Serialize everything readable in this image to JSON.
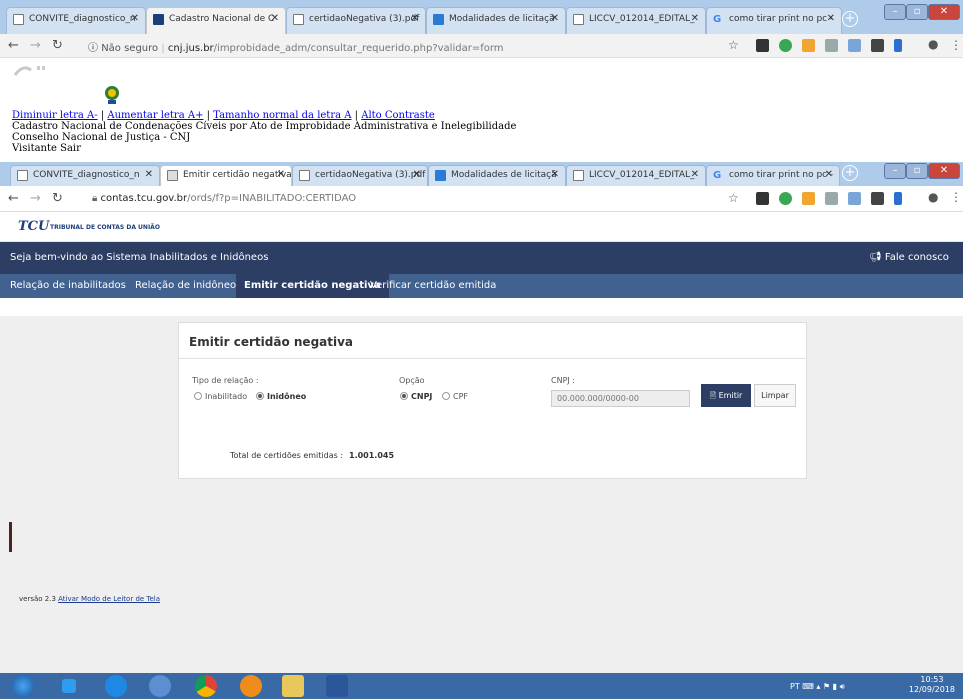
{
  "outer_browser": {
    "tabs": [
      {
        "label": "CONVITE_diagnostico_n"
      },
      {
        "label": "Cadastro Nacional de C"
      },
      {
        "label": "certidaoNegativa (3).pdf"
      },
      {
        "label": "Modalidades de licitaçã"
      },
      {
        "label": "LICCV_012014_EDITAL_"
      },
      {
        "label": "como tirar print no pc -"
      }
    ],
    "url_security": "Não seguro",
    "url_host": "cnj.jus.br",
    "url_path": "/improbidade_adm/consultar_requerido.php?validar=form"
  },
  "cnj_page": {
    "links": {
      "decrease": "Diminuir letra A-",
      "increase": "Aumentar letra A+",
      "normal": "Tamanho normal da letra A",
      "contrast": "Alto Contraste"
    },
    "sep": "|",
    "title": "Cadastro Nacional de Condenações Cíveis por Ato de Improbidade Administrativa e Inelegibilidade",
    "org": "Conselho Nacional de Justiça - CNJ",
    "user": "Visitante Sair"
  },
  "inner_browser": {
    "tabs": [
      {
        "label": "CONVITE_diagnostico_n"
      },
      {
        "label": "Emitir certidão negativa"
      },
      {
        "label": "certidaoNegativa (3).pdf"
      },
      {
        "label": "Modalidades de licitaçã"
      },
      {
        "label": "LICCV_012014_EDITAL_"
      },
      {
        "label": "como tirar print no pc -"
      }
    ],
    "url_host": "contas.tcu.gov.br",
    "url_path": "/ords/f?p=INABILITADO:CERTIDAO"
  },
  "tcu": {
    "logo": "TCU",
    "org_name": "TRIBUNAL DE CONTAS DA UNIÃO",
    "welcome": "Seja bem-vindo ao Sistema Inabilitados e Inidôneos",
    "contact": "Fale conosco",
    "menu": [
      "Relação de inabilitados",
      "Relação de inidôneos",
      "Emitir certidão negativa",
      "Verificar certidão emitida"
    ]
  },
  "form": {
    "title": "Emitir certidão negativa",
    "tipo_label": "Tipo de relação :",
    "tipo_options": [
      "Inabilitado",
      "Inidôneo"
    ],
    "opcao_label": "Opção",
    "opcao_options": [
      "CNPJ",
      "CPF"
    ],
    "cnpj_label": "CNPJ :",
    "cnpj_placeholder": "00.000.000/0000-00",
    "emitir": "Emitir",
    "limpar": "Limpar",
    "total_label": "Total de certidões emitidas :",
    "total_value": "1.001.045"
  },
  "footer": {
    "version": "versão 2.3",
    "link": "Ativar Modo de Leitor de Tela"
  },
  "taskbar": {
    "lang": "PT",
    "time": "10:53",
    "date": "12/09/2018"
  }
}
